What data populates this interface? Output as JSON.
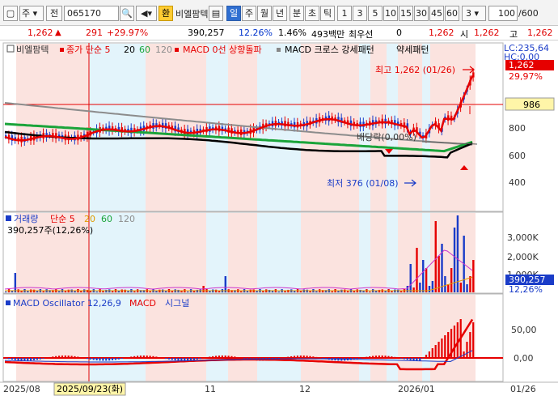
{
  "toolbar": {
    "code": "065170",
    "name_badge": "환",
    "name": "비엘팜텍",
    "jeon": "전",
    "ju": "주",
    "periods": [
      "일",
      "주",
      "월",
      "년",
      "분",
      "초",
      "틱"
    ],
    "intervals": [
      "1",
      "3",
      "5",
      "10",
      "15",
      "30",
      "45",
      "60"
    ],
    "interval_value": "3",
    "count": "100",
    "count_total": "/600"
  },
  "quote": {
    "price": "1,262",
    "change": "291",
    "change_pct": "+29.97%",
    "volume": "390,257",
    "turnover_pct": "12.26%",
    "ratio": "1.46%",
    "amount": "493백만",
    "pref_label": "최우선",
    "pref_value": "0",
    "price2": "1,262",
    "open_label": "시",
    "open": "1,262",
    "high_label": "고",
    "high": "1,262"
  },
  "legend": {
    "main": [
      "비엘팜텍",
      "종가 단순 5",
      "20",
      "60",
      "120",
      "MACD 0선 상향돌파",
      "MACD 크로스 강세패턴",
      "약세패턴"
    ],
    "volume": [
      "거래량",
      "단순 5",
      "20",
      "60",
      "120"
    ],
    "volume_value": "390,257주(12,26%)",
    "macd": [
      "MACD Oscillator 12,26,9",
      "MACD",
      "시그널"
    ]
  },
  "annotations": {
    "high": "최고 1,262 (01/26)",
    "low": "최저 376 (01/08)",
    "dividend": "배당락(0,00%)",
    "lc": "LC:235,64",
    "hc": "HC:0,00",
    "price_tag": "1,262",
    "price_pct": "29,97%",
    "line_tag": "986",
    "vol_tag": "390,257",
    "vol_pct": "12,26%"
  },
  "axes": {
    "price_ticks": [
      "800",
      "600",
      "400"
    ],
    "volume_ticks": [
      "3,000K",
      "2,000K",
      "1,000K"
    ],
    "macd_ticks": [
      "50,00",
      "0,00"
    ],
    "date_labels": [
      "2025/08",
      "2025/09/23(화)",
      "11",
      "12",
      "2026/01",
      "01/26"
    ]
  },
  "colors": {
    "red_band": "#fbe3df",
    "blue_band": "#e3f4fb",
    "up": "#e60000",
    "down": "#1a3cc8",
    "ma5": "#e60000",
    "ma20": "#000000",
    "ma60": "#1aa43a",
    "ma120": "#8c8c8c"
  }
}
